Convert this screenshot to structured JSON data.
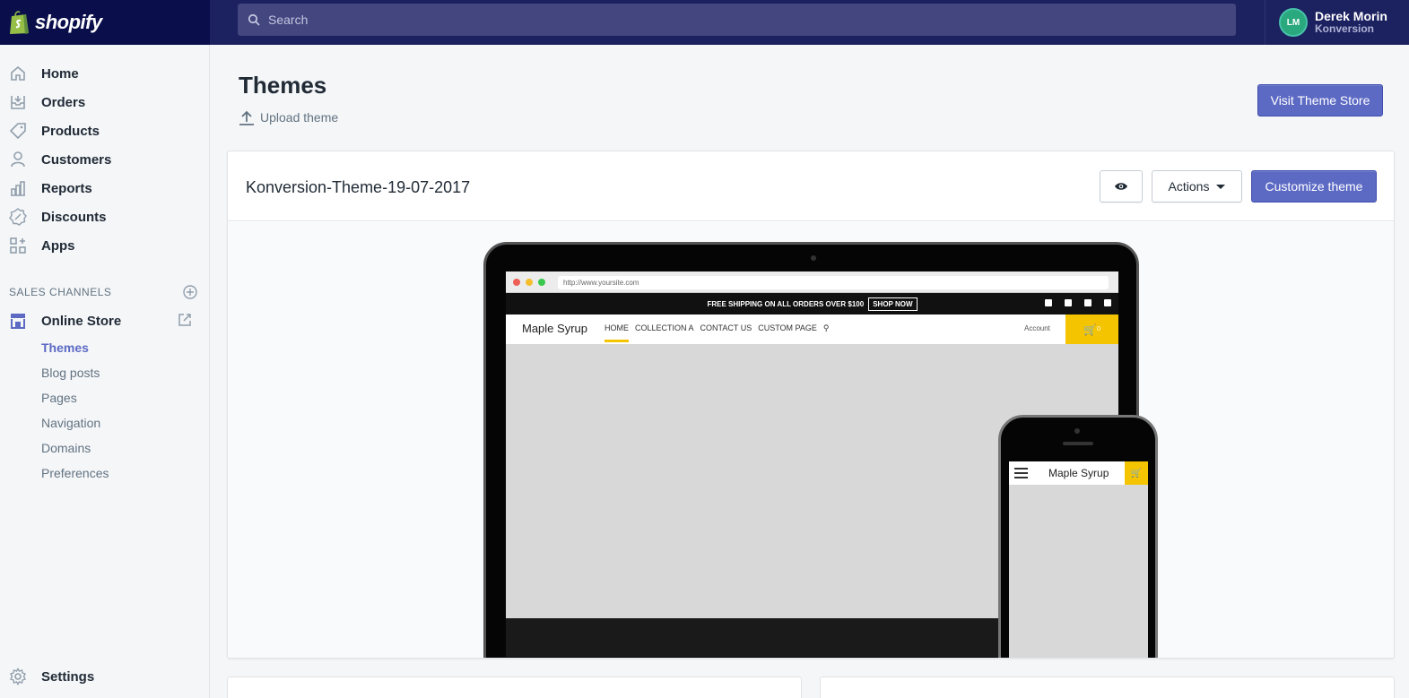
{
  "brand": {
    "name": "shopify"
  },
  "search": {
    "placeholder": "Search"
  },
  "user": {
    "name": "Derek Morin",
    "shop": "Konversion",
    "initials": "LM"
  },
  "sidebar": {
    "items": [
      {
        "label": "Home",
        "icon": "home-icon"
      },
      {
        "label": "Orders",
        "icon": "orders-icon"
      },
      {
        "label": "Products",
        "icon": "tag-icon"
      },
      {
        "label": "Customers",
        "icon": "person-icon"
      },
      {
        "label": "Reports",
        "icon": "bar-chart-icon"
      },
      {
        "label": "Discounts",
        "icon": "discount-icon"
      },
      {
        "label": "Apps",
        "icon": "apps-icon"
      }
    ],
    "channels_heading": "SALES CHANNELS",
    "online_store": "Online Store",
    "sub_items": [
      "Themes",
      "Blog posts",
      "Pages",
      "Navigation",
      "Domains",
      "Preferences"
    ],
    "active_sub": "Themes",
    "settings": "Settings"
  },
  "page": {
    "title": "Themes",
    "upload_label": "Upload theme",
    "visit_store_label": "Visit Theme Store"
  },
  "theme": {
    "name": "Konversion-Theme-19-07-2017",
    "actions_label": "Actions",
    "customize_label": "Customize theme"
  },
  "preview": {
    "url": "http://www.yoursite.com",
    "promo": "FREE SHIPPING ON ALL ORDERS OVER $100",
    "shop_now": "SHOP NOW",
    "site_name": "Maple Syrup",
    "nav_links": [
      "HOME",
      "COLLECTION A",
      "CONTACT US",
      "CUSTOM PAGE"
    ],
    "account": "Account",
    "cart_count": "0"
  },
  "colors": {
    "accent": "#5c6ac4",
    "topbar": "#1c2260",
    "theme_yellow": "#f5c400"
  }
}
